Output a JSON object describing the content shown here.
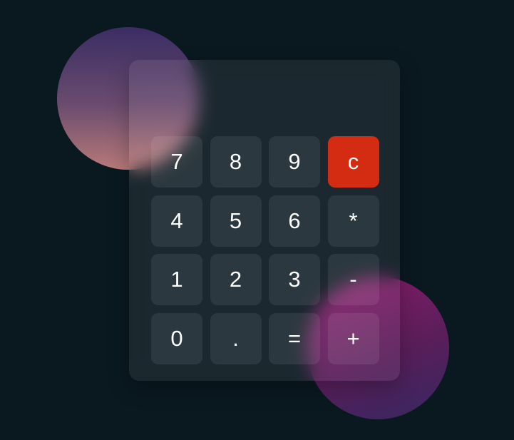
{
  "calculator": {
    "display": "",
    "keys": [
      {
        "label": "7",
        "name": "key-7"
      },
      {
        "label": "8",
        "name": "key-8"
      },
      {
        "label": "9",
        "name": "key-9"
      },
      {
        "label": "c",
        "name": "clear-button",
        "accent": "#d42c12"
      },
      {
        "label": "4",
        "name": "key-4"
      },
      {
        "label": "5",
        "name": "key-5"
      },
      {
        "label": "6",
        "name": "key-6"
      },
      {
        "label": "*",
        "name": "multiply-button"
      },
      {
        "label": "1",
        "name": "key-1"
      },
      {
        "label": "2",
        "name": "key-2"
      },
      {
        "label": "3",
        "name": "key-3"
      },
      {
        "label": "-",
        "name": "subtract-button"
      },
      {
        "label": "0",
        "name": "key-0"
      },
      {
        "label": ".",
        "name": "decimal-button"
      },
      {
        "label": "=",
        "name": "equals-button"
      },
      {
        "label": "+",
        "name": "add-button"
      }
    ]
  },
  "colors": {
    "background": "#0a1820",
    "clear_key": "#d42c12",
    "key_text": "#ffffff"
  }
}
